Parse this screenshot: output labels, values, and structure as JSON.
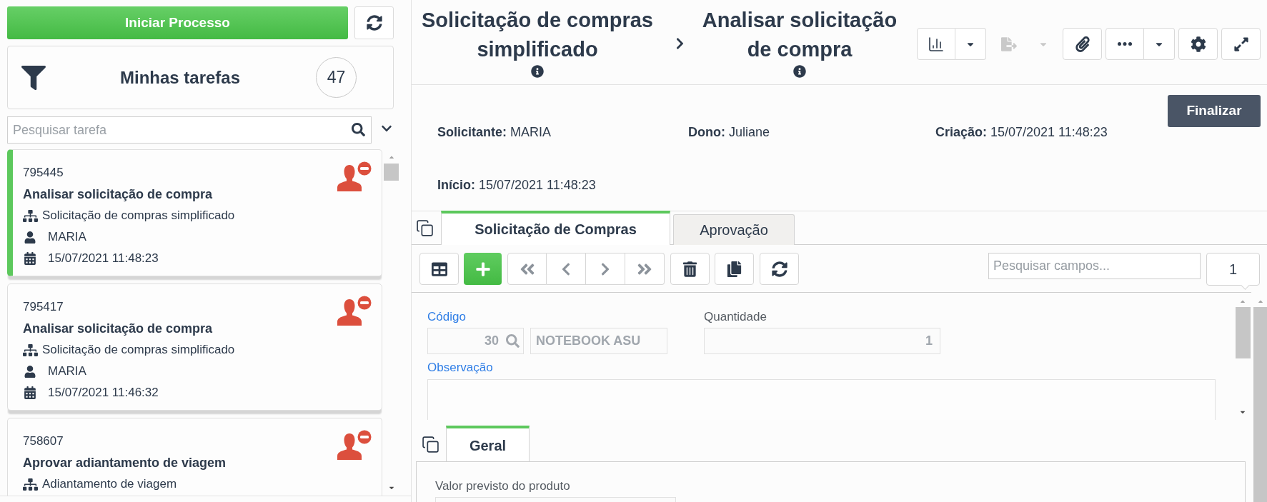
{
  "sidebar": {
    "start_button": "Iniciar Processo",
    "filter": {
      "title": "Minhas tarefas",
      "count": "47"
    },
    "search": {
      "placeholder": "Pesquisar tarefa"
    },
    "tasks": [
      {
        "id": "795445",
        "title": "Analisar solicitação de compra",
        "process": "Solicitação de compras simplificado",
        "user": "MARIA",
        "date": "15/07/2021 11:48:23",
        "selected": true
      },
      {
        "id": "795417",
        "title": "Analisar solicitação de compra",
        "process": "Solicitação de compras simplificado",
        "user": "MARIA",
        "date": "15/07/2021 11:46:32",
        "selected": false
      },
      {
        "id": "758607",
        "title": "Aprovar adiantamento de viagem",
        "process": "Adiantamento de viagem",
        "selected": false
      }
    ]
  },
  "header": {
    "breadcrumb": [
      "Solicitação de compras simplificado",
      "Analisar solicitação de compra"
    ],
    "toolbar": [
      {
        "kind": "chart",
        "split": true,
        "disabled": false
      },
      {
        "kind": "export",
        "split": true,
        "disabled": true
      },
      {
        "kind": "attach",
        "split": false,
        "disabled": false
      },
      {
        "kind": "more",
        "split": true,
        "disabled": false
      },
      {
        "kind": "settings",
        "split": false,
        "disabled": false
      },
      {
        "kind": "expand",
        "split": false,
        "disabled": false
      }
    ]
  },
  "details": {
    "finish_button": "Finalizar",
    "items": [
      {
        "label": "Solicitante:",
        "value": "MARIA"
      },
      {
        "label": "Dono:",
        "value": "Juliane"
      },
      {
        "label": "Criação:",
        "value": "15/07/2021 11:48:23"
      },
      {
        "label": "Início:",
        "value": "15/07/2021 11:48:23"
      }
    ]
  },
  "tabs": [
    {
      "label": "Solicitação de Compras",
      "selected": true
    },
    {
      "label": "Aprovação",
      "selected": false
    }
  ],
  "form_toolbar": {
    "search": {
      "placeholder": "Pesquisar campos..."
    },
    "record_counter": "1"
  },
  "fields": [
    {
      "kind": "lookup",
      "label": "Código",
      "link": true,
      "readonly": true,
      "code": "30",
      "description": "NOTEBOOK ASU"
    },
    {
      "kind": "number",
      "label": "Quantidade",
      "link": false,
      "readonly": true,
      "value": "1"
    },
    {
      "kind": "textarea",
      "label": "Observação",
      "link": true
    }
  ],
  "section": {
    "tabs": [
      {
        "label": "Geral",
        "selected": true
      }
    ],
    "fields": [
      {
        "label": "Valor previsto do produto"
      }
    ]
  }
}
